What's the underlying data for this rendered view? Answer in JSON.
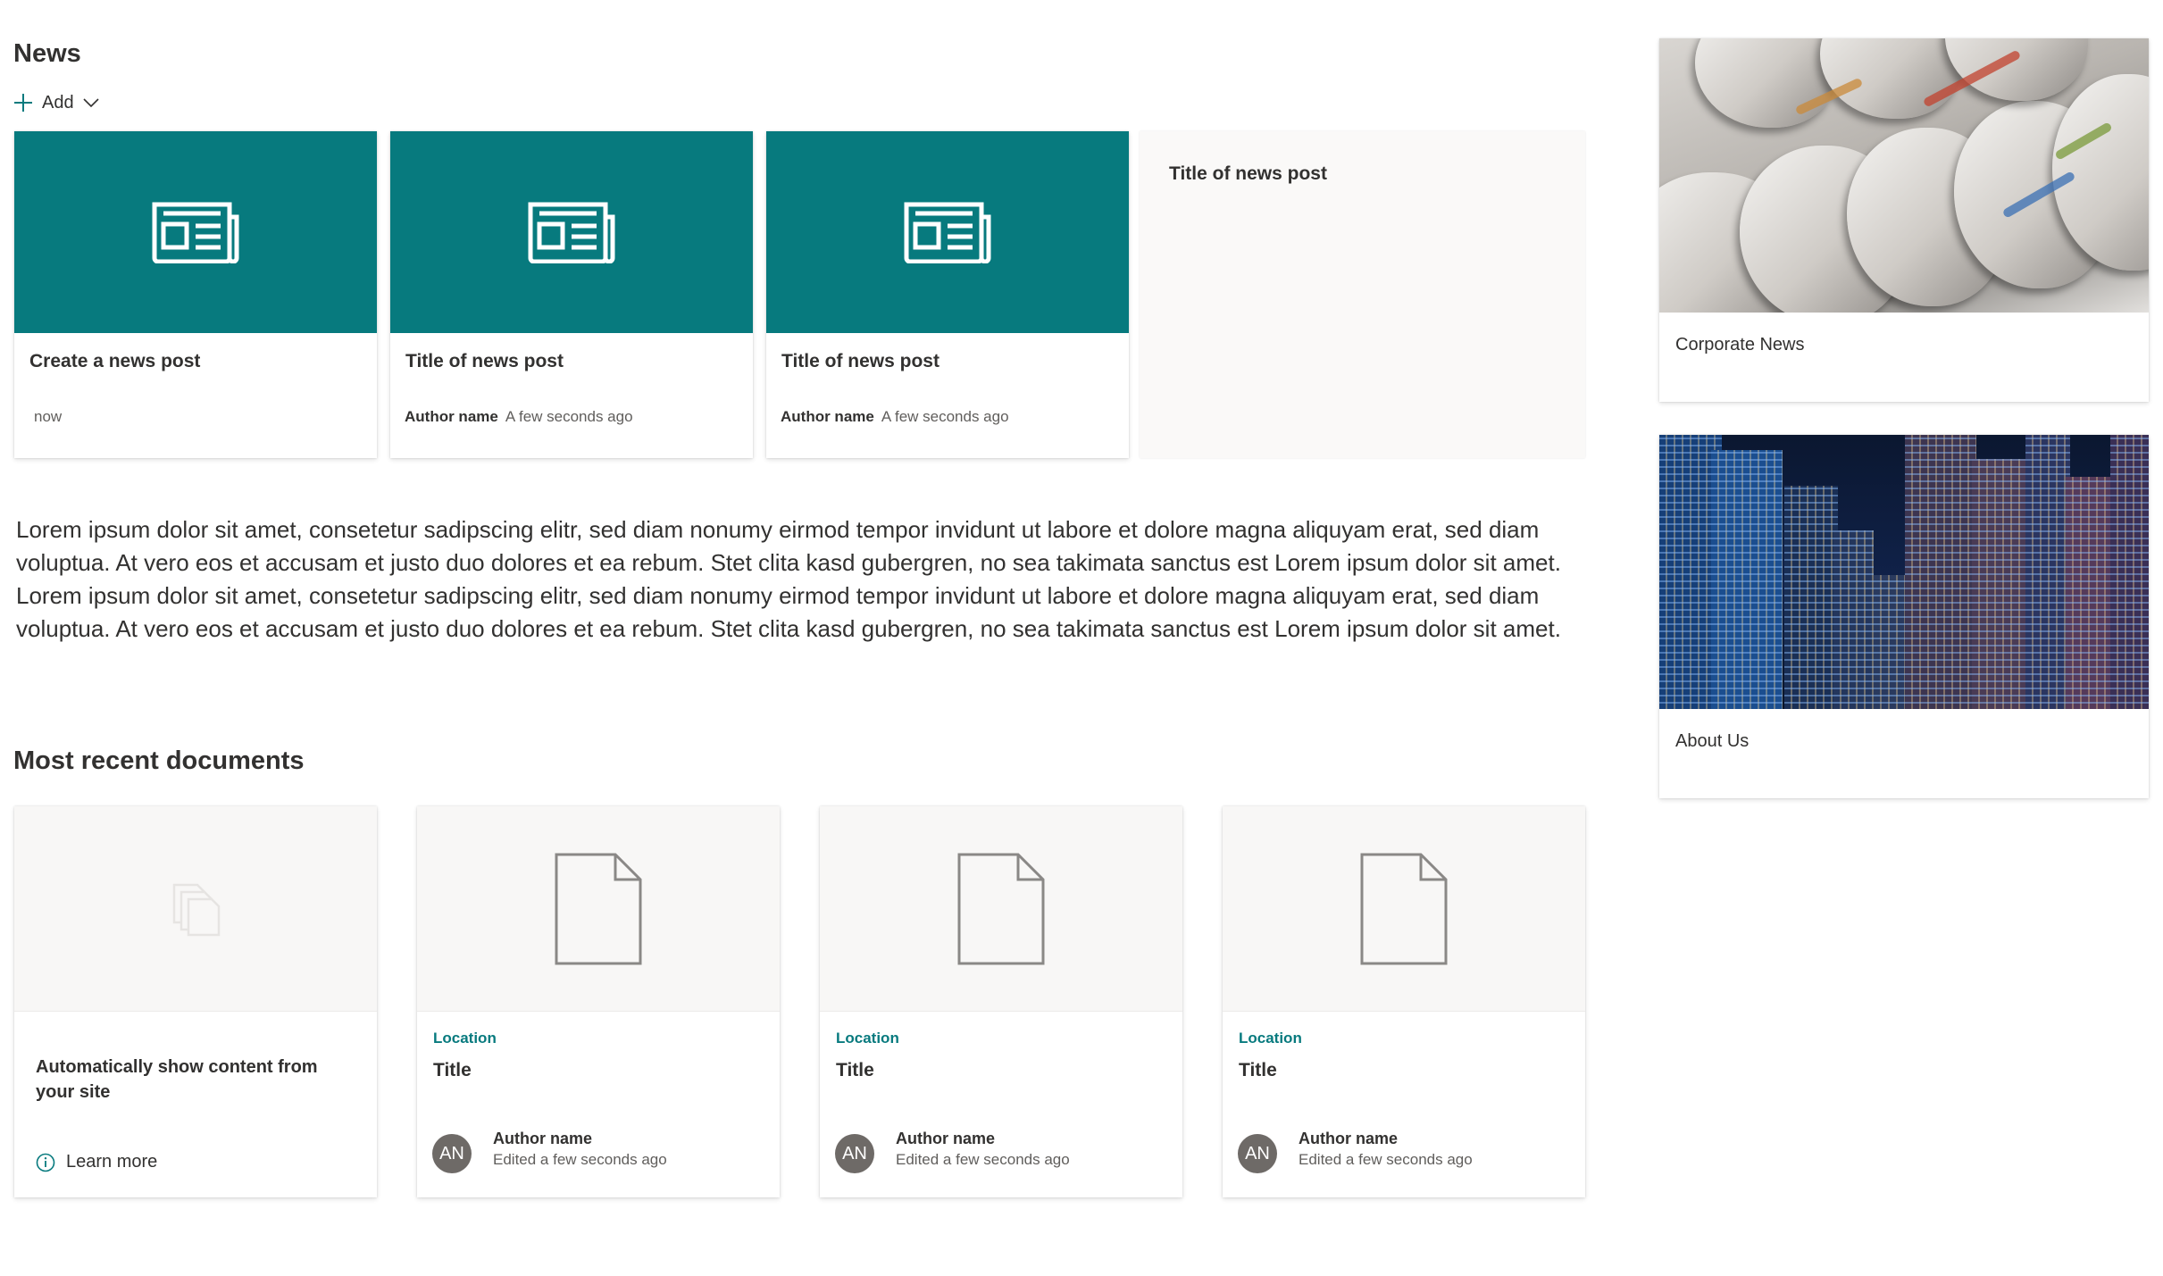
{
  "news": {
    "heading": "News",
    "add_label": "Add",
    "cards": [
      {
        "title": "Create a news post",
        "author": "",
        "time": "now"
      },
      {
        "title": "Title of news post",
        "author": "Author name",
        "time": "A few seconds ago"
      },
      {
        "title": "Title of news post",
        "author": "Author name",
        "time": "A few seconds ago"
      }
    ],
    "empty_card_title": "Title of news post"
  },
  "body_text": "Lorem ipsum dolor sit amet, consetetur sadipscing elitr, sed diam nonumy eirmod tempor invidunt ut labore et dolore magna aliquyam erat, sed diam voluptua. At vero eos et accusam et justo duo dolores et ea rebum. Stet clita kasd gubergren, no sea takimata sanctus est Lorem ipsum dolor sit amet. Lorem ipsum dolor sit amet, consetetur sadipscing elitr, sed diam nonumy eirmod tempor invidunt ut labore et dolore magna aliquyam erat, sed diam voluptua. At vero eos et accusam et justo duo dolores et ea rebum. Stet clita kasd gubergren, no sea takimata sanctus est Lorem ipsum dolor sit amet.",
  "documents": {
    "heading": "Most recent documents",
    "placeholder_text": "Automatically show content from your site",
    "learn_more": "Learn more",
    "items": [
      {
        "location": "Location",
        "title": "Title",
        "initials": "AN",
        "author": "Author name",
        "edited": "Edited a few seconds ago"
      },
      {
        "location": "Location",
        "title": "Title",
        "initials": "AN",
        "author": "Author name",
        "edited": "Edited a few seconds ago"
      },
      {
        "location": "Location",
        "title": "Title",
        "initials": "AN",
        "author": "Author name",
        "edited": "Edited a few seconds ago"
      }
    ]
  },
  "sidebar": {
    "cards": [
      {
        "label": "Corporate News",
        "image": "newspapers"
      },
      {
        "label": "About Us",
        "image": "city-skyline"
      }
    ]
  },
  "colors": {
    "accent": "#077a7e",
    "avatar": "#6e6a67"
  }
}
